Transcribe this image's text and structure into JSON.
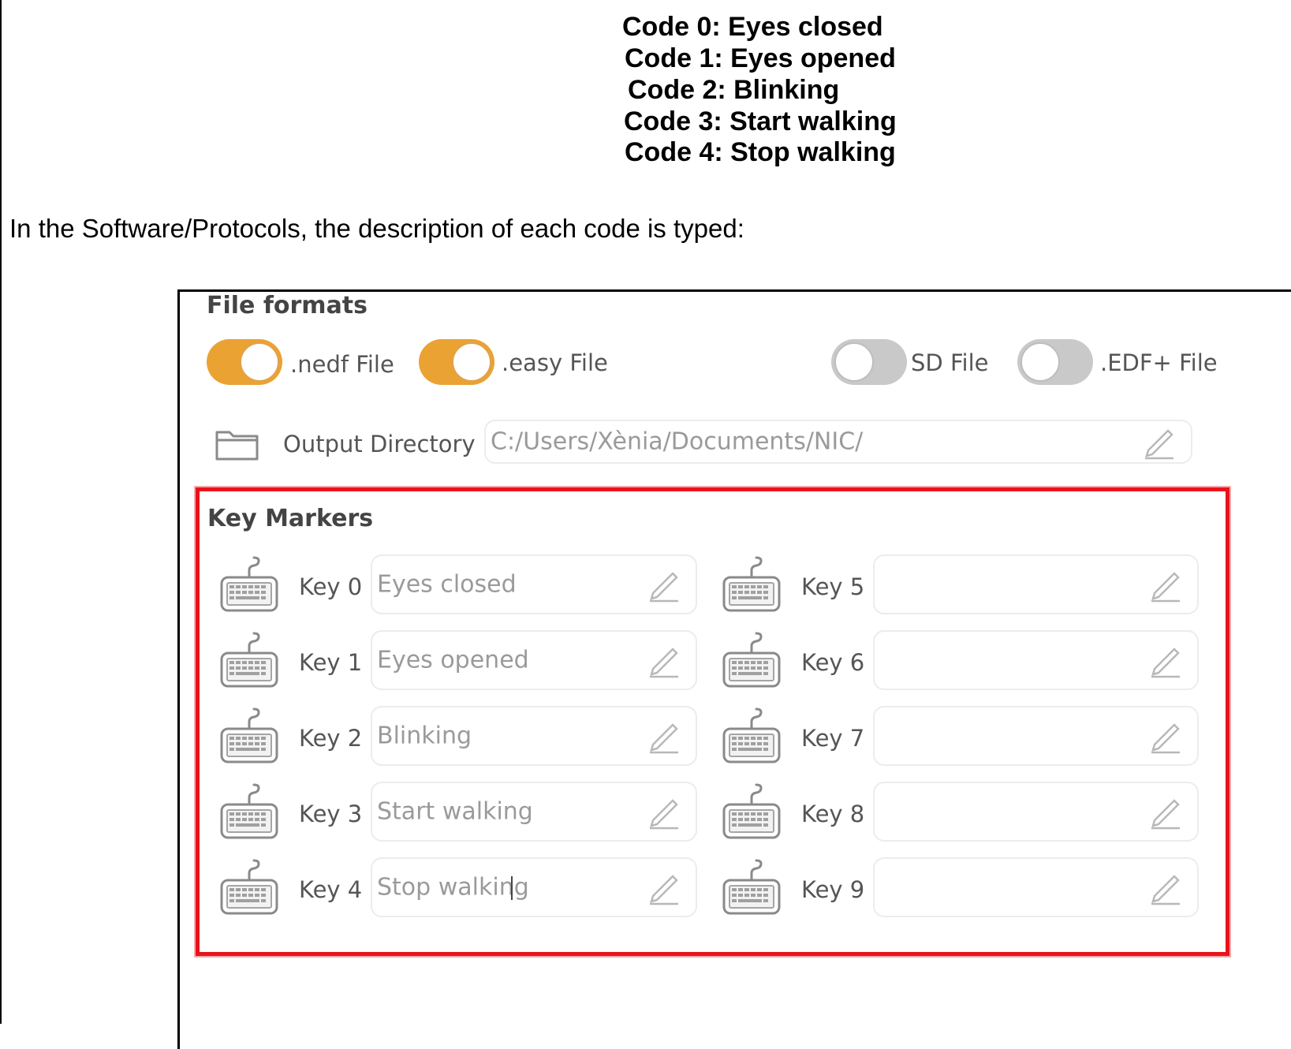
{
  "codes": [
    "Code 0: Eyes closed",
    "Code 1: Eyes opened",
    "Code 2: Blinking",
    "Code 3: Start walking",
    "Code 4: Stop walking"
  ],
  "intro_text": "In the Software/Protocols, the description of each code is typed:",
  "file_formats": {
    "title": "File formats",
    "toggles": [
      {
        "label": ".nedf File",
        "on": true
      },
      {
        "label": ".easy File",
        "on": true
      },
      {
        "label": "SD File",
        "on": false
      },
      {
        "label": ".EDF+ File",
        "on": false
      }
    ],
    "accent_color": "#eaa233"
  },
  "output_directory": {
    "label": "Output Directory",
    "value": "C:/Users/Xènia/Documents/NIC/"
  },
  "key_markers": {
    "title": "Key Markers",
    "highlight_color": "#e8131b",
    "keys": [
      {
        "label": "Key 0",
        "value": "Eyes closed"
      },
      {
        "label": "Key 1",
        "value": "Eyes opened"
      },
      {
        "label": "Key 2",
        "value": "Blinking"
      },
      {
        "label": "Key 3",
        "value": "Start walking"
      },
      {
        "label": "Key 4",
        "value": "Stop walking"
      },
      {
        "label": "Key 5",
        "value": ""
      },
      {
        "label": "Key 6",
        "value": ""
      },
      {
        "label": "Key 7",
        "value": ""
      },
      {
        "label": "Key 8",
        "value": ""
      },
      {
        "label": "Key 9",
        "value": ""
      }
    ]
  }
}
